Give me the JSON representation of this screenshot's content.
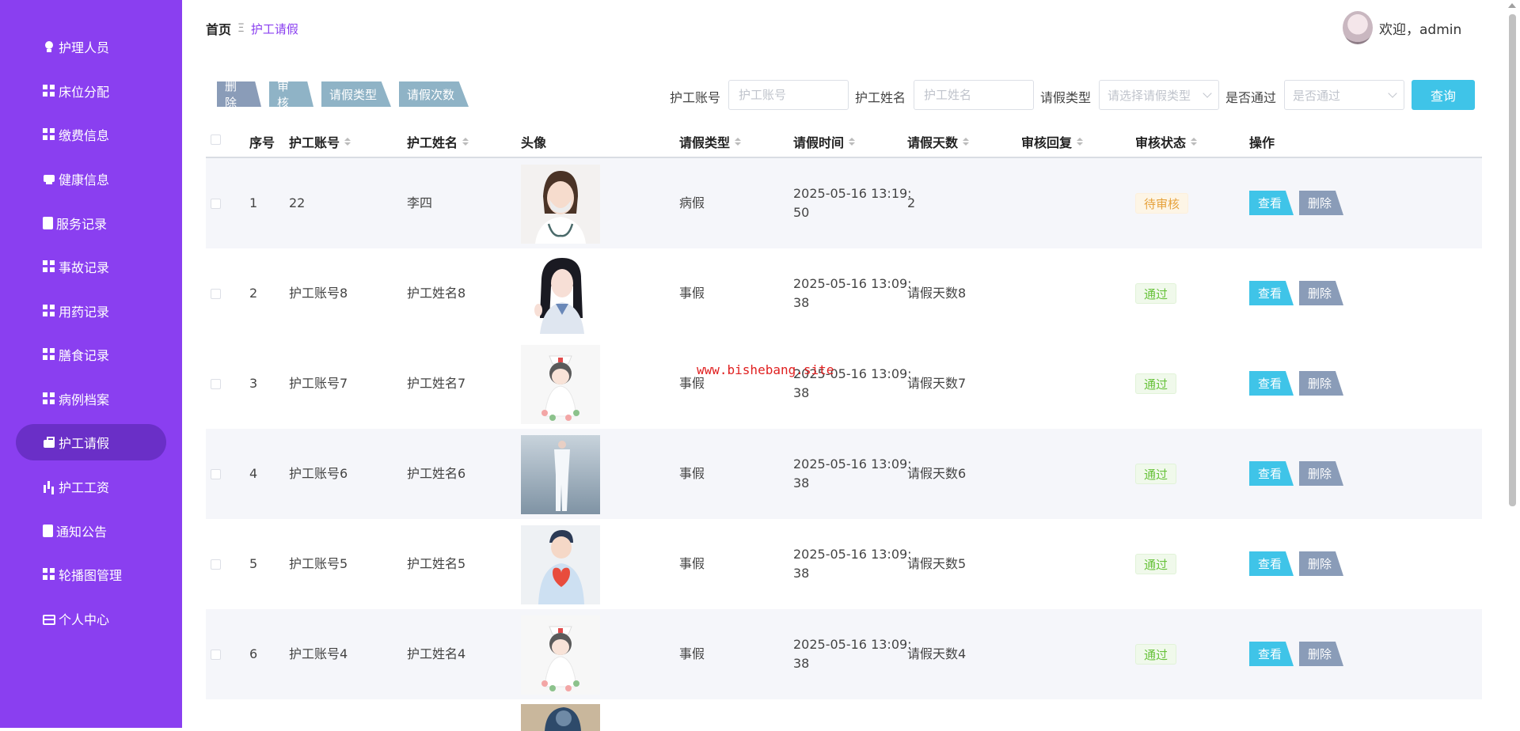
{
  "sidebar": {
    "items": [
      {
        "label": "护理人员",
        "icon": "lightbulb-icon",
        "active": false
      },
      {
        "label": "床位分配",
        "icon": "grid-icon",
        "active": false
      },
      {
        "label": "缴费信息",
        "icon": "grid-icon",
        "active": false
      },
      {
        "label": "健康信息",
        "icon": "printer-icon",
        "active": false
      },
      {
        "label": "服务记录",
        "icon": "clipboard-icon",
        "active": false
      },
      {
        "label": "事故记录",
        "icon": "grid-icon",
        "active": false
      },
      {
        "label": "用药记录",
        "icon": "grid-icon",
        "active": false
      },
      {
        "label": "膳食记录",
        "icon": "grid-icon",
        "active": false
      },
      {
        "label": "病例档案",
        "icon": "grid-icon",
        "active": false
      },
      {
        "label": "护工请假",
        "icon": "briefcase-icon",
        "active": true
      },
      {
        "label": "护工工资",
        "icon": "bar-chart-icon",
        "active": false
      },
      {
        "label": "通知公告",
        "icon": "clipboard-icon",
        "active": false
      },
      {
        "label": "轮播图管理",
        "icon": "grid-icon",
        "active": false
      },
      {
        "label": "个人中心",
        "icon": "card-icon",
        "active": false
      }
    ]
  },
  "header": {
    "breadcrumb_home": "首页",
    "breadcrumb_sep": "Ξ",
    "breadcrumb_current": "护工请假",
    "welcome": "欢迎，admin"
  },
  "toolbar": {
    "delete": "删除",
    "audit": "审核",
    "leave_type": "请假类型",
    "leave_count": "请假次数"
  },
  "filters": {
    "account_label": "护工账号",
    "account_placeholder": "护工账号",
    "name_label": "护工姓名",
    "name_placeholder": "护工姓名",
    "type_label": "请假类型",
    "type_placeholder": "请选择请假类型",
    "pass_label": "是否通过",
    "pass_placeholder": "是否通过",
    "search": "查询"
  },
  "table": {
    "headers": {
      "index": "序号",
      "account": "护工账号",
      "name": "护工姓名",
      "photo": "头像",
      "type": "请假类型",
      "time": "请假时间",
      "days": "请假天数",
      "reply": "审核回复",
      "status": "审核状态",
      "ops": "操作"
    },
    "view_label": "查看",
    "delete_label": "删除",
    "rows": [
      {
        "index": "1",
        "account": "22",
        "name": "李四",
        "type": "病假",
        "time_line1": "2025-05-16 13:19:",
        "time_line2": "50",
        "days": "2",
        "reply": "",
        "status": "待审核",
        "status_kind": "wait"
      },
      {
        "index": "2",
        "account": "护工账号8",
        "name": "护工姓名8",
        "type": "事假",
        "time_line1": "2025-05-16 13:09:",
        "time_line2": "38",
        "days": "请假天数8",
        "reply": "",
        "status": "通过",
        "status_kind": "pass"
      },
      {
        "index": "3",
        "account": "护工账号7",
        "name": "护工姓名7",
        "type": "事假",
        "time_line1": "2025-05-16 13:09:",
        "time_line2": "38",
        "days": "请假天数7",
        "reply": "",
        "status": "通过",
        "status_kind": "pass"
      },
      {
        "index": "4",
        "account": "护工账号6",
        "name": "护工姓名6",
        "type": "事假",
        "time_line1": "2025-05-16 13:09:",
        "time_line2": "38",
        "days": "请假天数6",
        "reply": "",
        "status": "通过",
        "status_kind": "pass"
      },
      {
        "index": "5",
        "account": "护工账号5",
        "name": "护工姓名5",
        "type": "事假",
        "time_line1": "2025-05-16 13:09:",
        "time_line2": "38",
        "days": "请假天数5",
        "reply": "",
        "status": "通过",
        "status_kind": "pass"
      },
      {
        "index": "6",
        "account": "护工账号4",
        "name": "护工姓名4",
        "type": "事假",
        "time_line1": "2025-05-16 13:09:",
        "time_line2": "38",
        "days": "请假天数4",
        "reply": "",
        "status": "通过",
        "status_kind": "pass"
      }
    ]
  },
  "watermark": "www.bishebang.site",
  "colors": {
    "sidebar_bg": "#8a3ff0",
    "sidebar_active": "#6a2fc7",
    "primary_button": "#3fc4e8",
    "gray_button": "#8a9cb8",
    "status_wait": "#e6a23c",
    "status_pass": "#67c23a"
  }
}
